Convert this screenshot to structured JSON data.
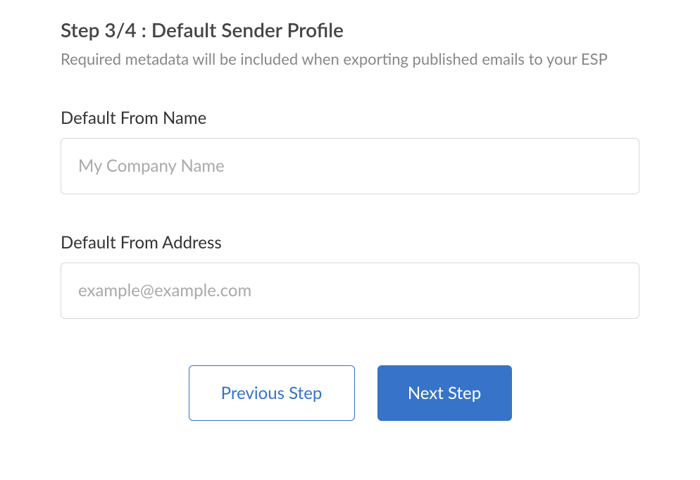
{
  "header": {
    "title": "Step 3/4 : Default Sender Profile",
    "subtitle": "Required metadata will be included when exporting published emails to your ESP"
  },
  "form": {
    "fromName": {
      "label": "Default From Name",
      "placeholder": "My Company Name",
      "value": ""
    },
    "fromAddress": {
      "label": "Default From Address",
      "placeholder": "example@example.com",
      "value": ""
    }
  },
  "buttons": {
    "previous": "Previous Step",
    "next": "Next Step"
  }
}
